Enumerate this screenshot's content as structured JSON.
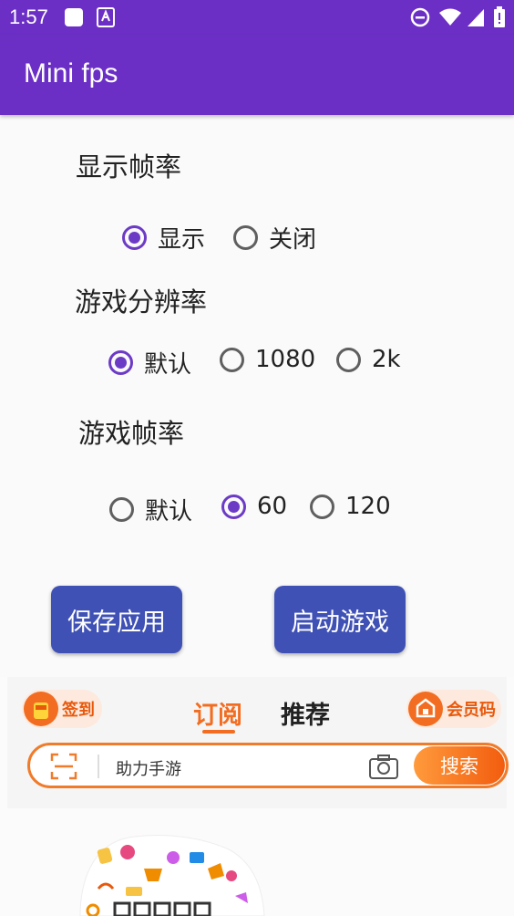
{
  "status_bar": {
    "time": "1:57"
  },
  "app_bar": {
    "title": "Mini fps"
  },
  "sections": {
    "display_fps": {
      "label": "显示帧率",
      "options": [
        {
          "label": "显示",
          "checked": true
        },
        {
          "label": "关闭",
          "checked": false
        }
      ]
    },
    "resolution": {
      "label": "游戏分辨率",
      "options": [
        {
          "label": "默认",
          "checked": true
        },
        {
          "label": "1080",
          "checked": false
        },
        {
          "label": "2k",
          "checked": false
        }
      ]
    },
    "game_fps": {
      "label": "游戏帧率",
      "options": [
        {
          "label": "默认",
          "checked": false
        },
        {
          "label": "60",
          "checked": true
        },
        {
          "label": "120",
          "checked": false
        }
      ]
    }
  },
  "buttons": {
    "save": "保存应用",
    "launch": "启动游戏"
  },
  "ad": {
    "checkin": "签到",
    "tabs": [
      {
        "label": "订阅",
        "active": true
      },
      {
        "label": "推荐",
        "active": false
      }
    ],
    "member_code": "会员码",
    "search_text": "助力手游",
    "search_button": "搜索"
  },
  "colors": {
    "app_bar": "#6c2fc6",
    "radio_checked": "#6c3bc6",
    "button": "#3f51b5",
    "ad_accent": "#f26d21"
  }
}
